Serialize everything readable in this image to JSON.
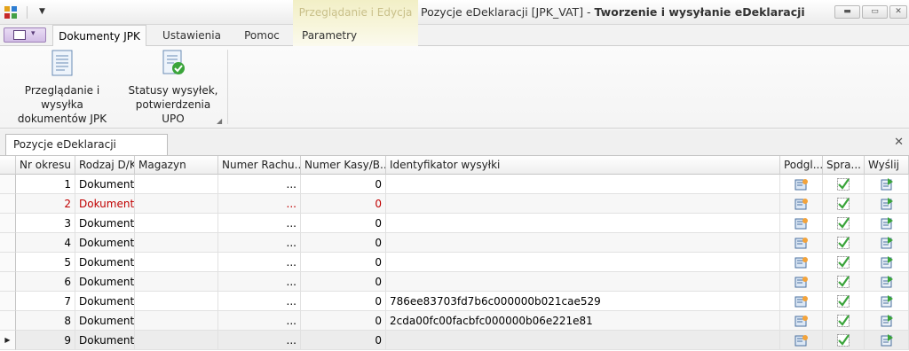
{
  "window": {
    "context_tab_title": "Przeglądanie i Edycja",
    "title_prefix": "Pozycje eDeklaracji [JPK_VAT] - ",
    "title_main": "Tworzenie i wysyłanie eDeklaracji",
    "qat_arrow": "▼",
    "minimize": "▬",
    "maximize": "▭",
    "close": "✕"
  },
  "ribbon": {
    "tabs": [
      {
        "label": "Dokumenty JPK"
      },
      {
        "label": "Ustawienia"
      },
      {
        "label": "Pomoc"
      },
      {
        "label": "Parametry"
      }
    ],
    "buttons": [
      {
        "line1": "Przeglądanie i wysyłka",
        "line2": "dokumentów JPK"
      },
      {
        "line1": "Statusy wysyłek,",
        "line2": "potwierdzenia UPO"
      }
    ],
    "group_launcher": "◢"
  },
  "document": {
    "tab_label": "Pozycje eDeklaracji [JPK_VAT]",
    "close_glyph": "✕"
  },
  "grid": {
    "columns": [
      "Nr okresu",
      "Rodzaj D/K",
      "Magazyn",
      "Numer Rachu...",
      "Numer Kasy/B...",
      "Identyfikator wysyłki",
      "Podgl...",
      "Spra...",
      "Wyślij"
    ],
    "current_row_marker": "▶",
    "rows": [
      {
        "nr": "1",
        "rodzaj": "Dokument",
        "magazyn": "",
        "rach": "...",
        "kasa": "0",
        "id": ""
      },
      {
        "nr": "2",
        "rodzaj": "Dokument",
        "magazyn": "",
        "rach": "...",
        "kasa": "0",
        "id": ""
      },
      {
        "nr": "3",
        "rodzaj": "Dokument",
        "magazyn": "",
        "rach": "...",
        "kasa": "0",
        "id": ""
      },
      {
        "nr": "4",
        "rodzaj": "Dokument",
        "magazyn": "",
        "rach": "...",
        "kasa": "0",
        "id": ""
      },
      {
        "nr": "5",
        "rodzaj": "Dokument",
        "magazyn": "",
        "rach": "...",
        "kasa": "0",
        "id": ""
      },
      {
        "nr": "6",
        "rodzaj": "Dokument",
        "magazyn": "",
        "rach": "...",
        "kasa": "0",
        "id": ""
      },
      {
        "nr": "7",
        "rodzaj": "Dokument",
        "magazyn": "",
        "rach": "...",
        "kasa": "0",
        "id": "786ee83703fd7b6c000000b021cae529"
      },
      {
        "nr": "8",
        "rodzaj": "Dokument",
        "magazyn": "",
        "rach": "...",
        "kasa": "0",
        "id": "2cda00fc00facbfc000000b06e221e81"
      },
      {
        "nr": "9",
        "rodzaj": "Dokument",
        "magazyn": "",
        "rach": "...",
        "kasa": "0",
        "id": ""
      }
    ]
  },
  "colors": {
    "context_tab": "#f2efc6",
    "highlight_row_text": "#c00000",
    "check_green": "#3aa43a"
  },
  "icons": [
    "app-icon",
    "app-menu-icon",
    "document-list-icon",
    "document-status-icon",
    "preview-icon",
    "check-icon",
    "send-icon"
  ]
}
